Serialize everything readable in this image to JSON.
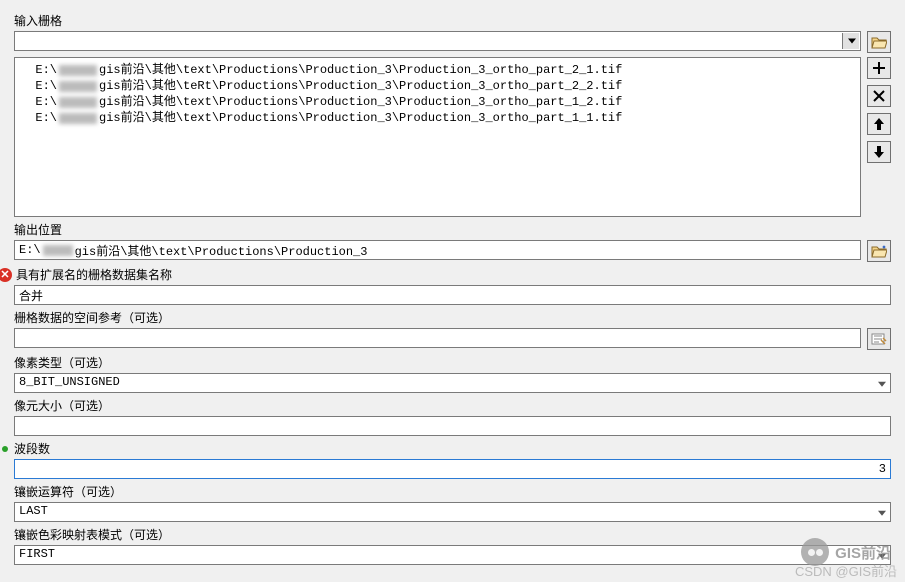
{
  "labels": {
    "input_raster": "输入栅格",
    "output_location": "输出位置",
    "dataset_name": "具有扩展名的栅格数据集名称",
    "spatial_ref": "栅格数据的空间参考（可选）",
    "pixel_type": "像素类型（可选）",
    "cell_size": "像元大小（可选）",
    "band_count": "波段数",
    "mosaic_op": "镶嵌运算符（可选）",
    "colormap_mode": "镶嵌色彩映射表模式（可选）"
  },
  "values": {
    "input_raster_dropdown": "",
    "output_location": "E:\\       gis前沿\\其他\\text\\Productions\\Production_3",
    "dataset_name": "合并",
    "spatial_ref": "",
    "pixel_type": "8_BIT_UNSIGNED",
    "cell_size": "",
    "band_count": "3",
    "mosaic_op": "LAST",
    "colormap_mode": "FIRST"
  },
  "file_list": {
    "prefix": "E:\\",
    "suffix_list": [
      "gis前沿\\其他\\text\\Productions\\Production_3\\Production_3_ortho_part_2_1.tif",
      "gis前沿\\其他\\teRt\\Productions\\Production_3\\Production_3_ortho_part_2_2.tif",
      "gis前沿\\其他\\text\\Productions\\Production_3\\Production_3_ortho_part_1_2.tif",
      "gis前沿\\其他\\text\\Productions\\Production_3\\Production_3_ortho_part_1_1.tif"
    ]
  },
  "watermark": {
    "logo_text": "GIS前沿",
    "csdn": "CSDN @GIS前沿"
  }
}
